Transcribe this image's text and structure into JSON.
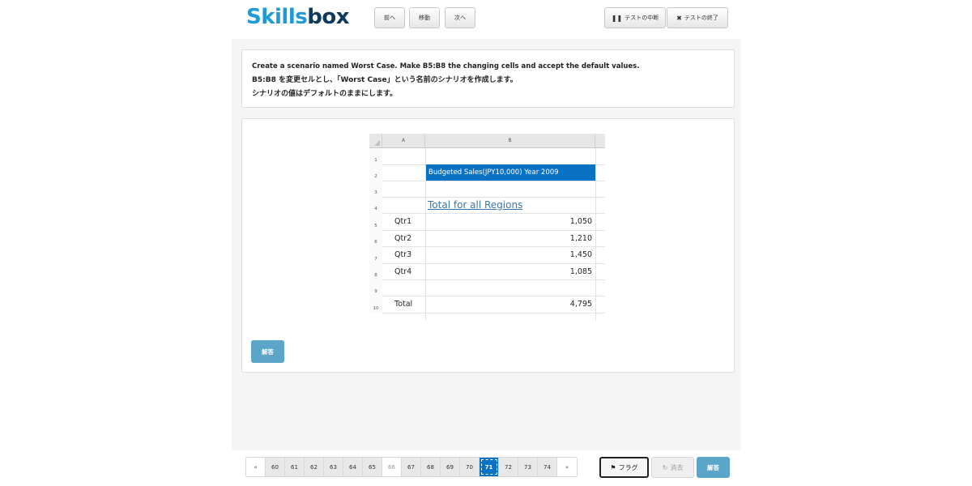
{
  "header": {
    "logo_skills": "Skills",
    "logo_box": "box",
    "prev_label": "前へ",
    "move_label": "移動",
    "next_label": "次へ",
    "pause_label": "テストの中断",
    "end_label": "テストの終了"
  },
  "instruction": {
    "line1": "Create a scenario named Worst Case. Make B5:B8 the changing cells and accept the default values.",
    "line2": "B5:B8 を変更セルとし、「Worst Case」という名前のシナリオを作成します。",
    "line3": "シナリオの値はデフォルトのままにします。"
  },
  "sheet": {
    "columns": [
      "A",
      "B"
    ],
    "rows": [
      "1",
      "2",
      "3",
      "4",
      "5",
      "6",
      "7",
      "8",
      "9",
      "10"
    ],
    "banner": "Budgeted Sales(JPY10,000) Year 2009",
    "title": "Total for all Regions",
    "labels": [
      "Qtr1",
      "Qtr2",
      "Qtr3",
      "Qtr4"
    ],
    "values": [
      "1,050",
      "1,210",
      "1,450",
      "1,085"
    ],
    "total_label": "Total",
    "total_value": "4,795"
  },
  "panel": {
    "answer_label": "解答"
  },
  "footer": {
    "prev_symbol": "«",
    "next_symbol": "»",
    "pages": [
      "60",
      "61",
      "62",
      "63",
      "64",
      "65",
      "66",
      "67",
      "68",
      "69",
      "70",
      "71",
      "72",
      "73",
      "74"
    ],
    "current_page": "71",
    "flag_label": "フラグ",
    "erase_label": "消去",
    "answer_label": "解答"
  },
  "colors": {
    "accent": "#0a72c5",
    "answer_button": "#5aa5c8",
    "logo_light": "#1f9ad6",
    "logo_dark": "#0f3a5f"
  }
}
